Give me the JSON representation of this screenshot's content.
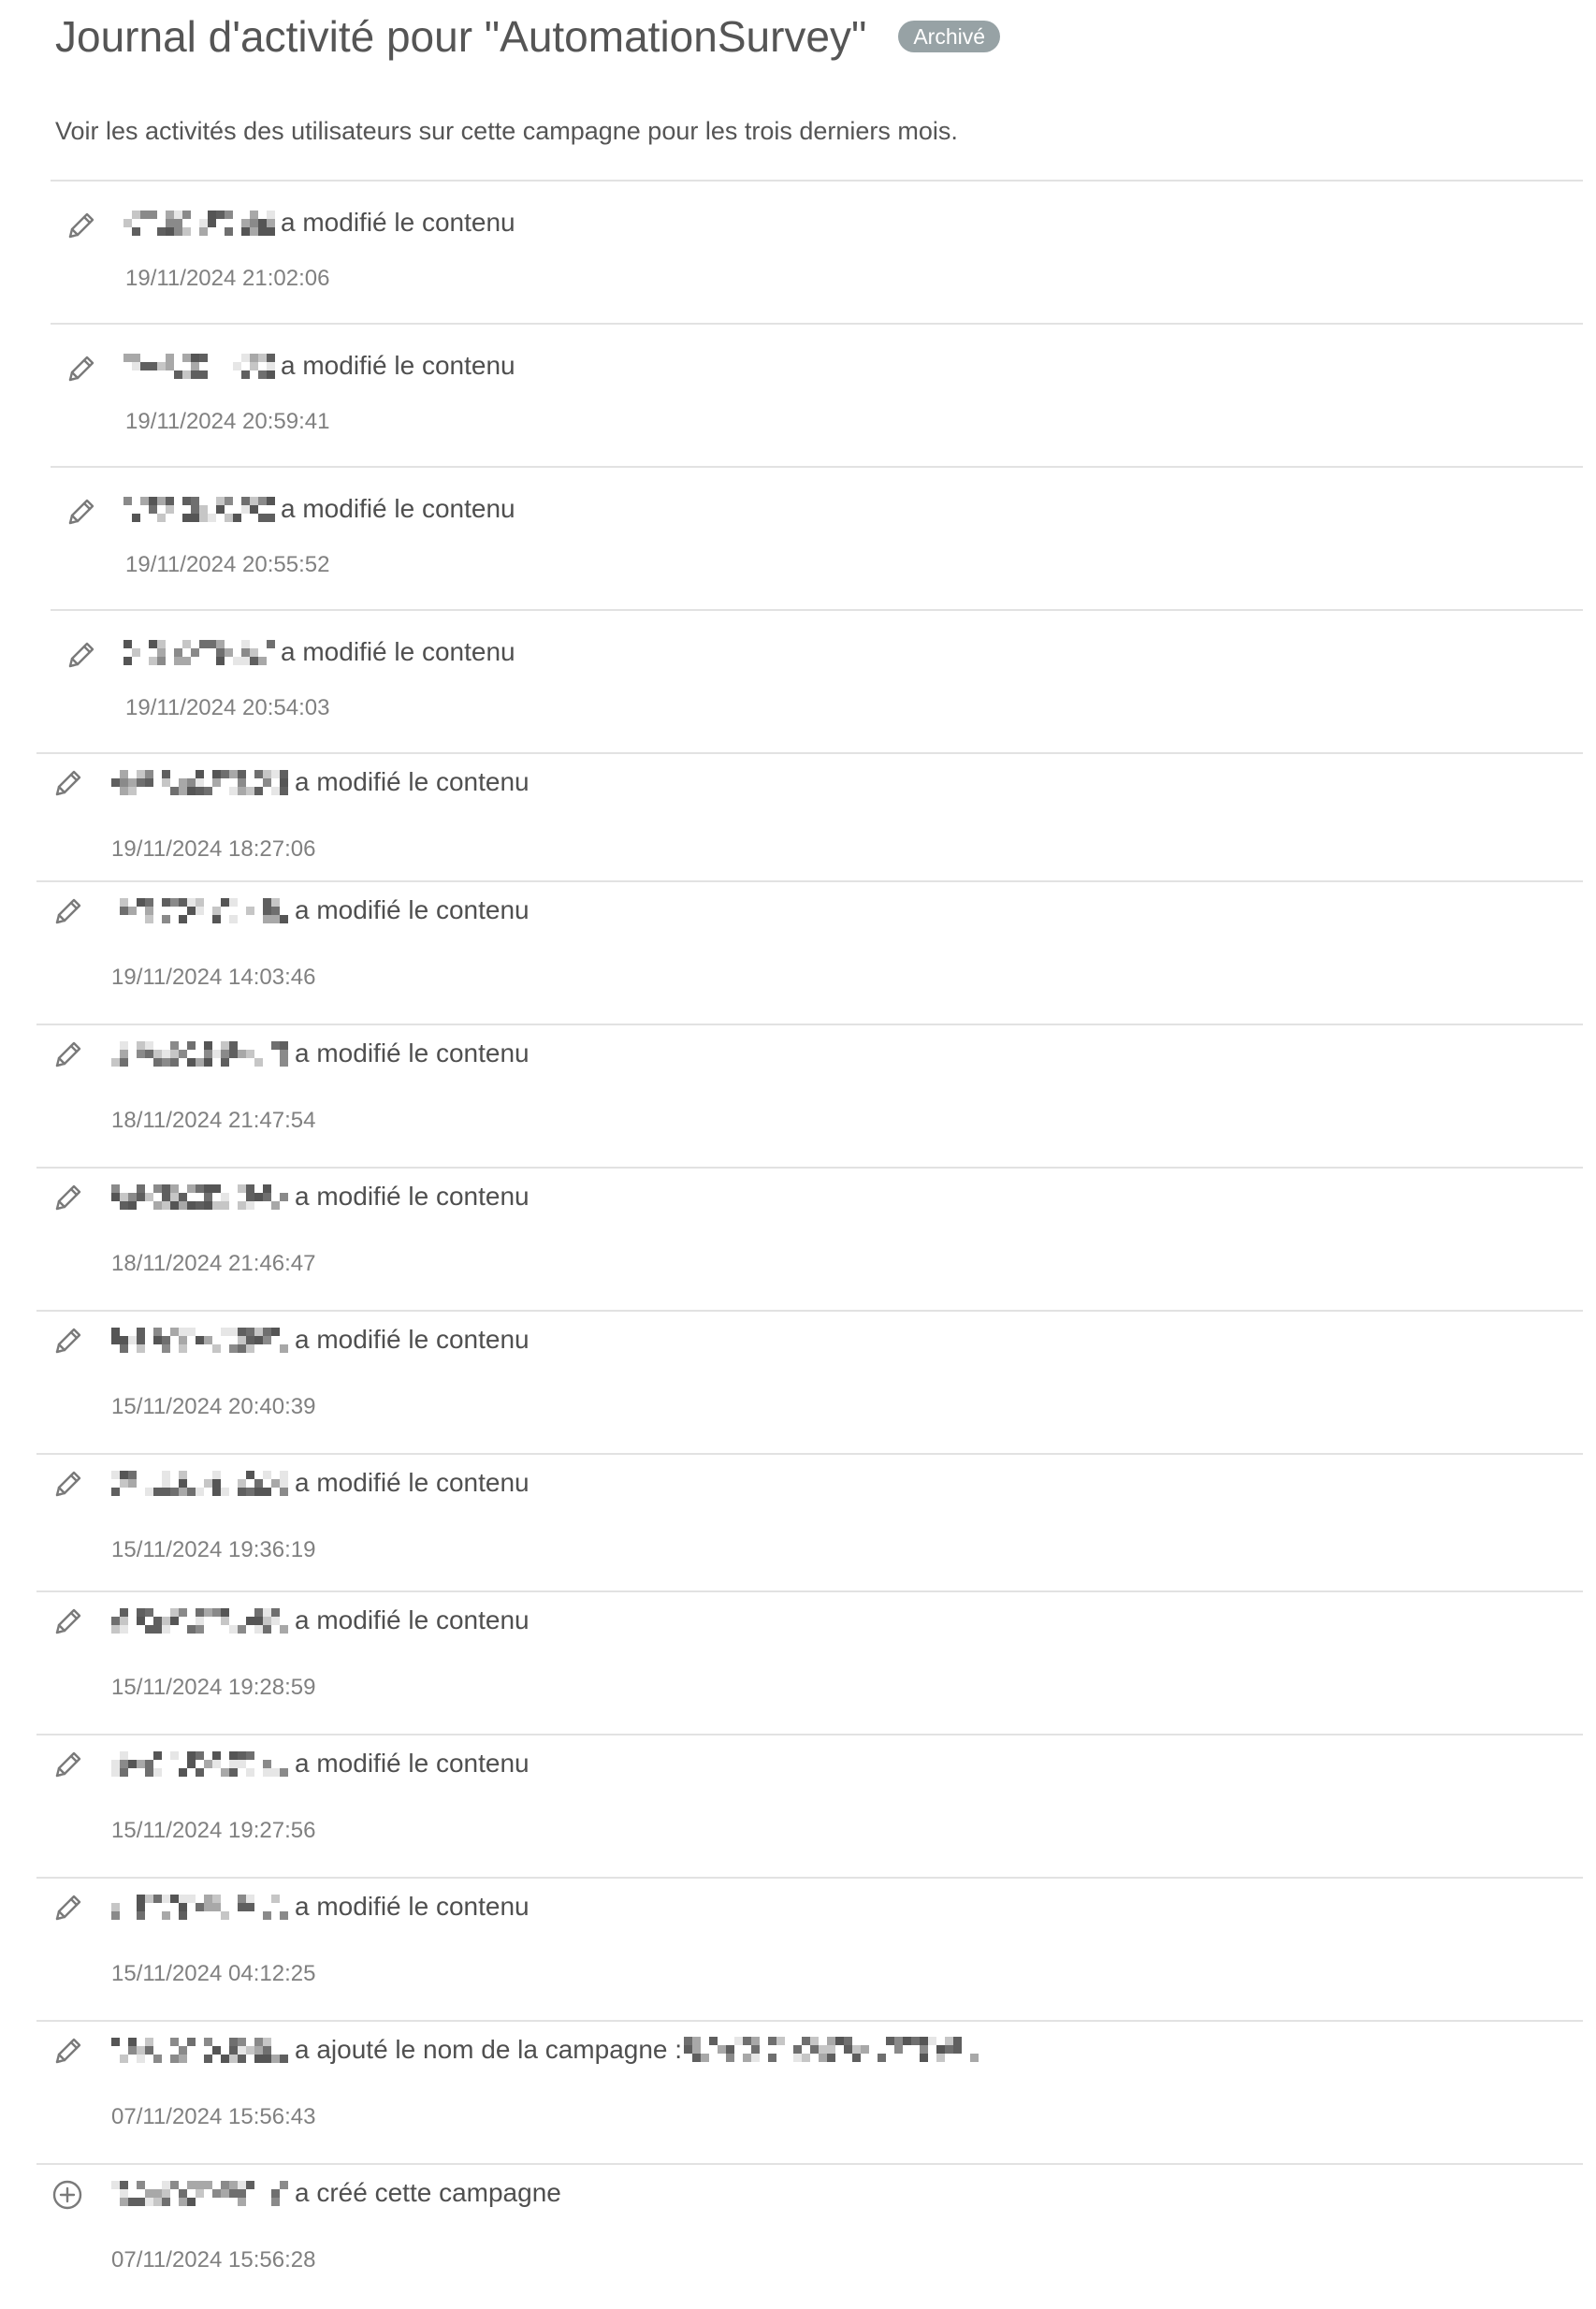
{
  "header": {
    "title": "Journal d'activité pour \"AutomationSurvey\"",
    "status_badge": "Archivé"
  },
  "description": "Voir les activités des utilisateurs sur cette campagne pour les trois derniers mois.",
  "icons": {
    "edit": "pencil-icon",
    "create": "plus-circle-icon"
  },
  "colors": {
    "badge_bg": "#97a2a5",
    "divider": "#e2e2e2",
    "timestamp": "#808080",
    "text": "#4f4f4f"
  },
  "activities": [
    {
      "icon": "pencil-icon",
      "action": "a modifié le contenu",
      "timestamp": "19/11/2024 21:02:06"
    },
    {
      "icon": "pencil-icon",
      "action": "a modifié le contenu",
      "timestamp": "19/11/2024 20:59:41"
    },
    {
      "icon": "pencil-icon",
      "action": "a modifié le contenu",
      "timestamp": "19/11/2024 20:55:52"
    },
    {
      "icon": "pencil-icon",
      "action": "a modifié le contenu",
      "timestamp": "19/11/2024 20:54:03"
    },
    {
      "icon": "pencil-icon",
      "action": "a modifié le contenu",
      "timestamp": "19/11/2024 18:27:06"
    },
    {
      "icon": "pencil-icon",
      "action": "a modifié le contenu",
      "timestamp": "19/11/2024 14:03:46"
    },
    {
      "icon": "pencil-icon",
      "action": "a modifié le contenu",
      "timestamp": "18/11/2024 21:47:54"
    },
    {
      "icon": "pencil-icon",
      "action": "a modifié le contenu",
      "timestamp": "18/11/2024 21:46:47"
    },
    {
      "icon": "pencil-icon",
      "action": "a modifié le contenu",
      "timestamp": "15/11/2024 20:40:39"
    },
    {
      "icon": "pencil-icon",
      "action": "a modifié le contenu",
      "timestamp": "15/11/2024 19:36:19"
    },
    {
      "icon": "pencil-icon",
      "action": "a modifié le contenu",
      "timestamp": "15/11/2024 19:28:59"
    },
    {
      "icon": "pencil-icon",
      "action": "a modifié le contenu",
      "timestamp": "15/11/2024 19:27:56"
    },
    {
      "icon": "pencil-icon",
      "action": "a modifié le contenu",
      "timestamp": "15/11/2024 04:12:25"
    },
    {
      "icon": "pencil-icon",
      "action": "a ajouté le nom de la campagne :",
      "timestamp": "07/11/2024 15:56:43"
    },
    {
      "icon": "plus-circle-icon",
      "action": "a créé cette campagne",
      "timestamp": "07/11/2024 15:56:28"
    }
  ]
}
